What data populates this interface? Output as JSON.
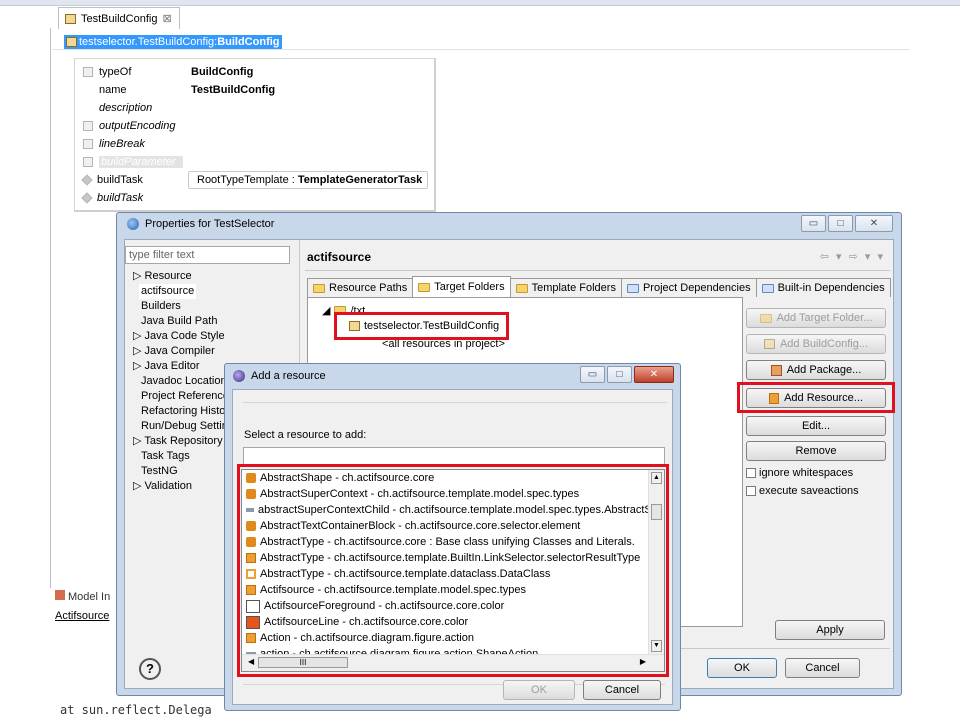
{
  "editor": {
    "tab_label": "TestBuildConfig",
    "close_glyph": "⊠",
    "breadcrumb_prefix": "testselector.TestBuildConfig:",
    "breadcrumb_bold": "BuildConfig"
  },
  "tree": {
    "rows": [
      {
        "key": "typeOf",
        "value": "BuildConfig"
      },
      {
        "key": "name",
        "value": "TestBuildConfig"
      },
      {
        "key": "description",
        "value": ""
      },
      {
        "key": "outputEncoding",
        "value": ""
      },
      {
        "key": "lineBreak",
        "value": ""
      },
      {
        "key": "buildParameter",
        "value": ""
      },
      {
        "key": "buildTask",
        "value": ""
      },
      {
        "key": "buildTask",
        "value": ""
      }
    ],
    "buildtask_prefix": "RootTypeTemplate : ",
    "buildtask_bold": "TemplateGeneratorTask"
  },
  "properties": {
    "title": "Properties for TestSelector",
    "filter_placeholder": "type filter text",
    "nav": [
      "▷ Resource",
      "actifsource",
      "Builders",
      "Java Build Path",
      "▷ Java Code Style",
      "▷ Java Compiler",
      "▷ Java Editor",
      "Javadoc Location",
      "Project References",
      "Refactoring History",
      "Run/Debug Settings",
      "▷ Task Repository",
      "Task Tags",
      "TestNG",
      "▷ Validation"
    ],
    "page_title": "actifsource",
    "nav_arrows": "⇦ ▾ ⇨ ▾ ▾",
    "tabs": [
      "Resource Paths",
      "Target Folders",
      "Template Folders",
      "Project Dependencies",
      "Built-in Dependencies"
    ],
    "folder_node": "/txt",
    "config_node": "testselector.TestBuildConfig",
    "all_resources": "<all resources in project>",
    "buttons": {
      "add_target_folder": "Add Target Folder...",
      "add_build_config": "Add BuildConfig...",
      "add_package": "Add Package...",
      "add_resource": "Add Resource...",
      "edit": "Edit...",
      "remove": "Remove",
      "apply": "Apply",
      "ok": "OK",
      "cancel": "Cancel"
    },
    "checkboxes": [
      "ignore whitespaces",
      "execute saveactions"
    ],
    "help_glyph": "?"
  },
  "add_resource": {
    "title": "Add a resource",
    "prompt": "Select a resource to add:",
    "search_value": "",
    "items": [
      {
        "text": "AbstractShape - ch.actifsource.core",
        "icon": "class-icon",
        "color": "#e08a1e"
      },
      {
        "text": "AbstractSuperContext - ch.actifsource.template.model.spec.types",
        "icon": "class-icon",
        "color": "#e08a1e"
      },
      {
        "text": "abstractSuperContextChild - ch.actifsource.template.model.spec.types.AbstractSup",
        "icon": "relation-icon",
        "color": "#8a9aa9"
      },
      {
        "text": "AbstractTextContainerBlock - ch.actifsource.core.selector.element",
        "icon": "class-icon",
        "color": "#e08a1e"
      },
      {
        "text": "AbstractType - ch.actifsource.core : Base class unifying Classes and Literals.",
        "icon": "class-icon",
        "color": "#e08a1e"
      },
      {
        "text": "AbstractType - ch.actifsource.template.BuiltIn.LinkSelector.selectorResultType",
        "icon": "resource-icon",
        "color": "#f0a030"
      },
      {
        "text": "AbstractType - ch.actifsource.template.dataclass.DataClass",
        "icon": "dataclass-icon",
        "color": "#f0a030"
      },
      {
        "text": "Actifsource - ch.actifsource.template.model.spec.types",
        "icon": "resource-icon",
        "color": "#f0a030"
      },
      {
        "text": "ActifsourceForeground - ch.actifsource.core.color",
        "icon": "color-swatch-icon",
        "color": "#ffffff"
      },
      {
        "text": "ActifsourceLine - ch.actifsource.core.color",
        "icon": "color-swatch-icon",
        "color": "#e8551a"
      },
      {
        "text": "Action - ch.actifsource.diagram.figure.action",
        "icon": "resource-icon",
        "color": "#f0a030"
      },
      {
        "text": "action - ch.actifsource.diagram.figure.action.ShapeAction",
        "icon": "relation-icon",
        "color": "#8a9aa9"
      }
    ],
    "ok": "OK",
    "cancel": "Cancel",
    "hscroll_thumb": "III"
  },
  "background": {
    "model_inspector": "Model In",
    "actifsource_label": "Actifsource",
    "console_line": "at sun.reflect.Delega"
  }
}
